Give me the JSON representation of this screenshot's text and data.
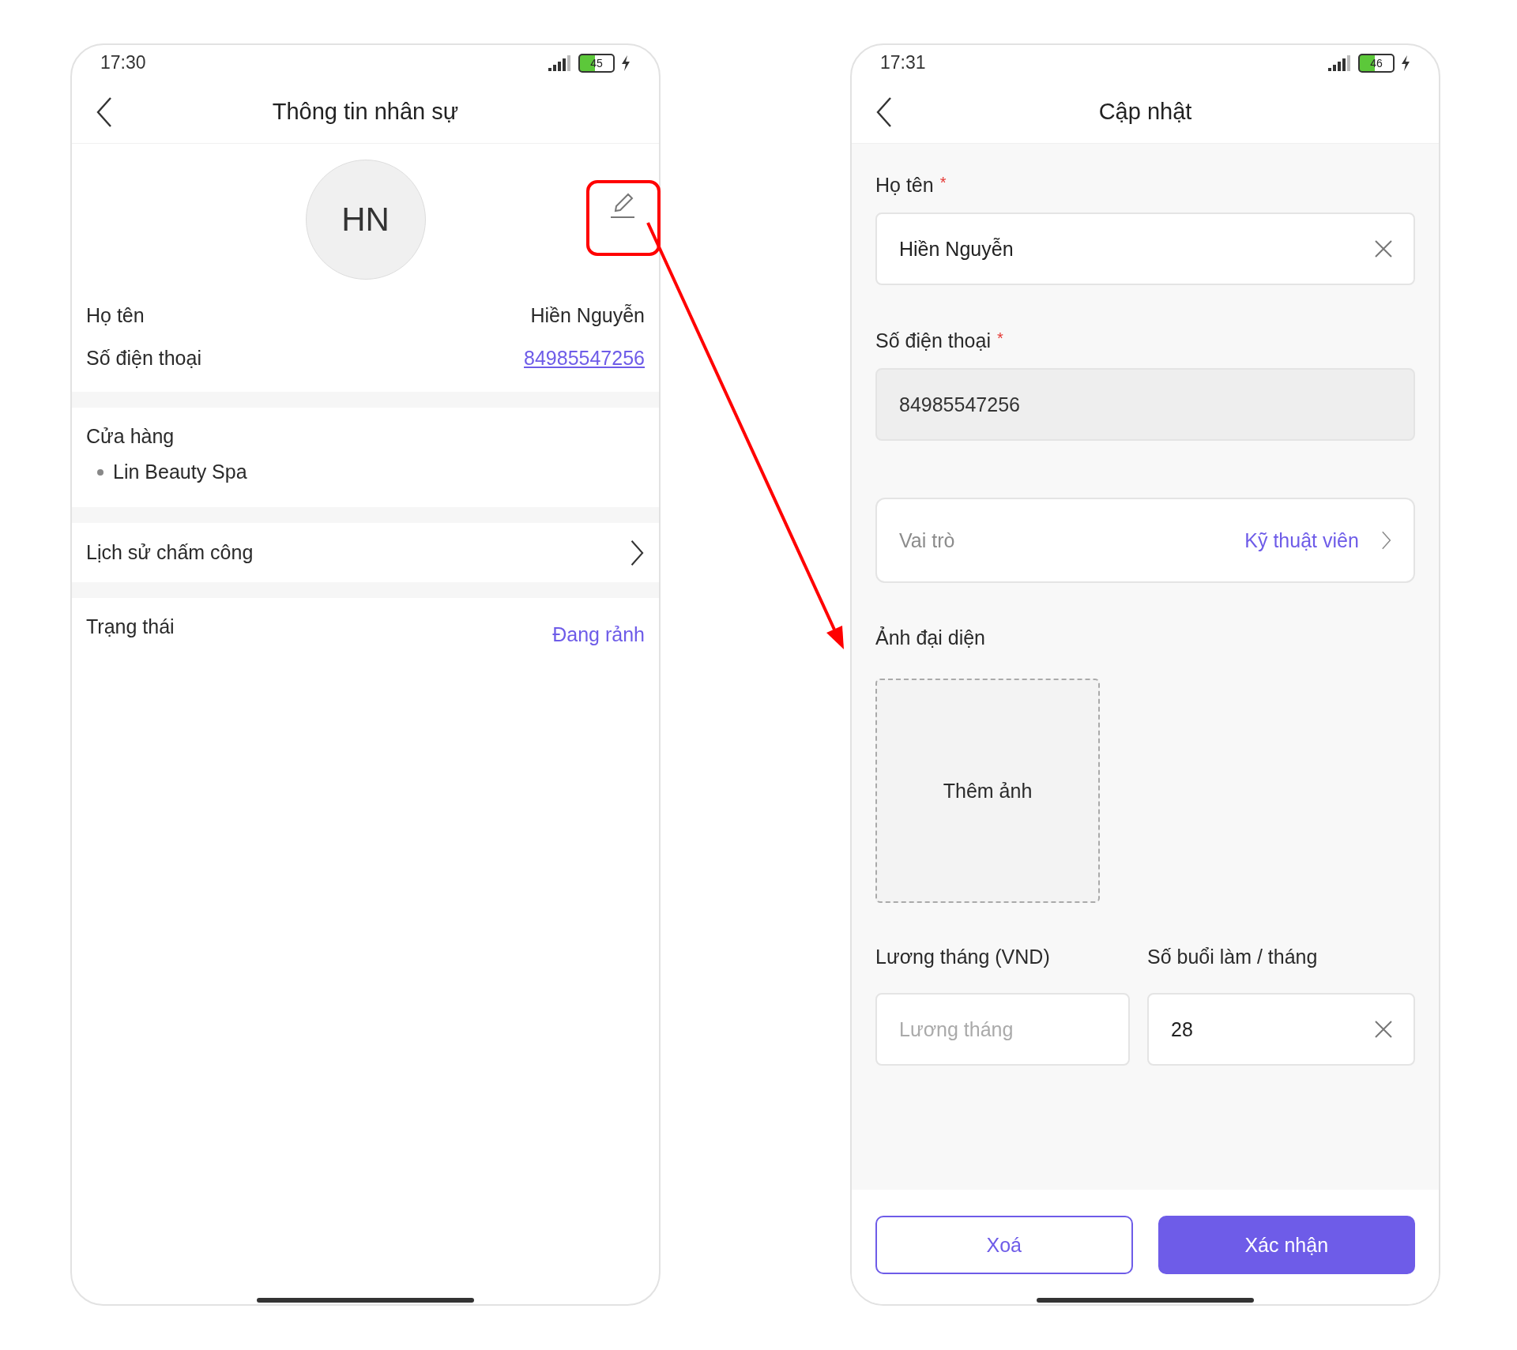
{
  "detail_screen": {
    "status_bar": {
      "time": "17:30",
      "battery": "45"
    },
    "title": "Thông tin nhân sự",
    "avatar": {
      "initials": "HN"
    },
    "info_rows": [
      {
        "label": "Họ tên",
        "value": "Hiền Nguyễn",
        "kind": "text"
      },
      {
        "label": "Số điện thoại",
        "value": "84985547256",
        "kind": "link"
      }
    ],
    "store": {
      "label": "Cửa hàng",
      "items": [
        "Lin Beauty Spa"
      ]
    },
    "attendance_history": {
      "label": "Lịch sử chấm công"
    },
    "status": {
      "label": "Trạng thái",
      "value": "Đang rảnh"
    }
  },
  "update_screen": {
    "status_bar": {
      "time": "17:31",
      "battery": "46"
    },
    "title": "Cập nhật",
    "name_field": {
      "label": "Họ tên",
      "required_mark": "*",
      "value": "Hiền Nguyễn",
      "disabled": false
    },
    "phone_field": {
      "label": "Số điện thoại",
      "required_mark": "*",
      "value": "84985547256",
      "disabled": true
    },
    "role": {
      "label": "Vai trò",
      "value": "Kỹ thuật viên"
    },
    "avatar_upload": {
      "label": "Ảnh đại diện",
      "button": "Thêm ảnh"
    },
    "salary_field": {
      "label": "Lương tháng (VND)",
      "placeholder": "Lương tháng"
    },
    "sessions_field": {
      "label": "Số buổi làm / tháng",
      "value": "28"
    },
    "buttons": [
      {
        "label": "Xoá",
        "kind": "outline"
      },
      {
        "label": "Xác nhận",
        "kind": "primary"
      }
    ]
  }
}
